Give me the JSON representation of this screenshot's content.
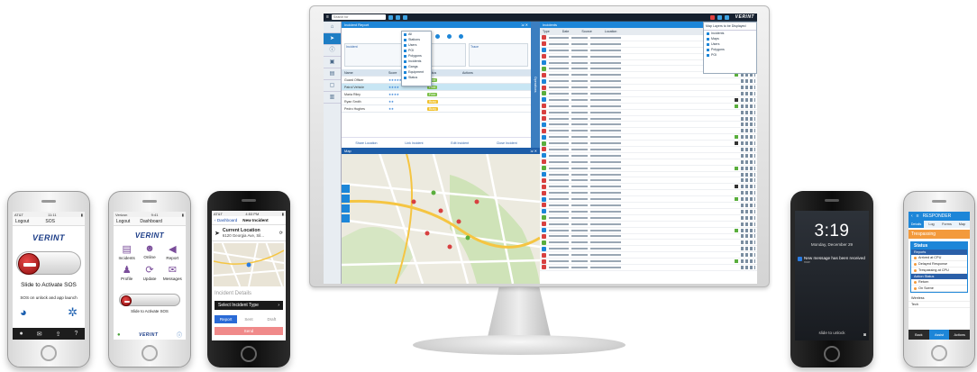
{
  "phone1": {
    "status_carrier": "AT&T",
    "status_time": "11:11",
    "nav_left": "Logout",
    "nav_title": "SOS",
    "brand": "VERINT",
    "slide_text": "Slide to Activate SOS",
    "sub_text": "SOS on unlock and app launch"
  },
  "phone2": {
    "status_carrier": "Verizon",
    "status_time": "9:41",
    "nav_left": "Logout",
    "nav_title": "Dashboard",
    "brand": "VERINT",
    "tiles": [
      "Incidents",
      "Online",
      "Report",
      "Profile",
      "Update",
      "Messages"
    ],
    "slide_text": "Slide to Activate SOS"
  },
  "phone3": {
    "status_carrier": "AT&T",
    "status_time": "4:53 PM",
    "back_label": "Dashboard",
    "title": "New Incident",
    "loc_title": "Current Location",
    "loc_addr": "6120 Georgia Ave, Sil...",
    "section": "Incident Details",
    "select_type": "Select Incident Type",
    "tabs": [
      "Report",
      "Sent",
      "Draft"
    ],
    "send": "Send"
  },
  "phone4": {
    "time": "3:19",
    "date": "Monday, December 29",
    "notification": "New message has been received",
    "notification_sub": "now",
    "unlock": "slide to unlock"
  },
  "phone5": {
    "header": "RESPONDER",
    "tabs": [
      "Details",
      "Log",
      "Forms",
      "Map"
    ],
    "incident": "Trespassing",
    "modal_title": "Status",
    "section_a": "Reports",
    "items": [
      "Arrived at CPU",
      "Delayed Response",
      "Trespassing at CPU"
    ],
    "section_b": "Action Status",
    "items_b": [
      "Return",
      "On Scene"
    ],
    "row_a": "Wireless",
    "row_b": "Tech",
    "footer": [
      "Back",
      "Assist",
      "Actions"
    ]
  },
  "desktop": {
    "search_placeholder": "Search for",
    "brand": "VERINT",
    "incident_panel_title": "Incident Report",
    "tiles": [
      "Incident",
      "Status",
      "Trace"
    ],
    "filter_options": [
      "All",
      "Stations",
      "Users",
      "POI",
      "Polygons",
      "Incidents",
      "Gangs",
      "Equipment",
      "Status"
    ],
    "list_header": [
      "Name",
      "Score",
      "Status",
      "Actions"
    ],
    "rows": [
      {
        "name": "Guard Officer",
        "rating": "★★★★★",
        "status": "Free"
      },
      {
        "name": "Patrol Vehicle",
        "rating": "★★★★",
        "status": "Free"
      },
      {
        "name": "Maria Riley",
        "rating": "★★★★",
        "status": "Free"
      },
      {
        "name": "Ryan Smith",
        "rating": "★★",
        "status": "Busy"
      },
      {
        "name": "Pedro Hughes",
        "rating": "★★",
        "status": "Busy"
      }
    ],
    "actions": [
      "Share Location",
      "Link Incident",
      "Edit Incident",
      "Close Incident"
    ],
    "side_tab": "Operations",
    "map_title": "Map",
    "table_title": "Incidents",
    "table_columns": [
      "Type",
      "Date",
      "Source",
      "Location",
      "Status",
      "Actions"
    ],
    "layers_title": "Map Layers to be Displayed",
    "layers": [
      "Incidents",
      "Maps",
      "Users",
      "Polygons",
      "POI"
    ],
    "colors": {
      "accent": "#1d86d8",
      "alert": "#d84040",
      "ok": "#5aae3d",
      "warn": "#f39a3c"
    }
  }
}
